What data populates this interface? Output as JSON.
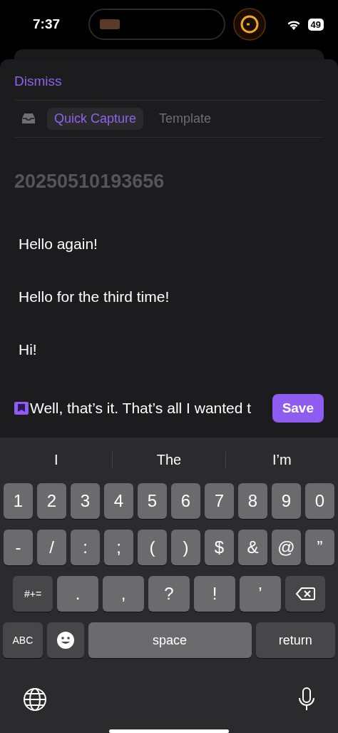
{
  "status_bar": {
    "time": "7:37",
    "battery": "49"
  },
  "sheet": {
    "dismiss": "Dismiss",
    "tabs": [
      {
        "label": "Quick Capture",
        "selected": true
      },
      {
        "label": "Template",
        "selected": false
      }
    ],
    "title_placeholder": "20250510193656",
    "lines": [
      "Hello again!",
      "Hello for the third time!",
      "Hi!",
      "Well, that’s it. That’s all I wanted t"
    ],
    "save": "Save"
  },
  "keyboard": {
    "suggestions": [
      "I",
      "The",
      "I’m"
    ],
    "rows": [
      {
        "keys": [
          {
            "label": "1",
            "kind": "char"
          },
          {
            "label": "2",
            "kind": "char"
          },
          {
            "label": "3",
            "kind": "char"
          },
          {
            "label": "4",
            "kind": "char"
          },
          {
            "label": "5",
            "kind": "char"
          },
          {
            "label": "6",
            "kind": "char"
          },
          {
            "label": "7",
            "kind": "char"
          },
          {
            "label": "8",
            "kind": "char"
          },
          {
            "label": "9",
            "kind": "char"
          },
          {
            "label": "0",
            "kind": "char"
          }
        ]
      },
      {
        "keys": [
          {
            "label": "-",
            "kind": "char"
          },
          {
            "label": "/",
            "kind": "char"
          },
          {
            "label": ":",
            "kind": "char"
          },
          {
            "label": ";",
            "kind": "char"
          },
          {
            "label": "(",
            "kind": "char"
          },
          {
            "label": ")",
            "kind": "char"
          },
          {
            "label": "$",
            "kind": "char"
          },
          {
            "label": "&",
            "kind": "char"
          },
          {
            "label": "@",
            "kind": "char"
          },
          {
            "label": "”",
            "kind": "char"
          }
        ]
      },
      {
        "keys": [
          {
            "label": "#+=",
            "kind": "mod"
          },
          {
            "label": ".",
            "kind": "wide"
          },
          {
            "label": ",",
            "kind": "wide"
          },
          {
            "label": "?",
            "kind": "wide"
          },
          {
            "label": "!",
            "kind": "wide"
          },
          {
            "label": "’",
            "kind": "wide"
          },
          {
            "kind": "delete"
          }
        ]
      },
      {
        "keys": [
          {
            "label": "ABC",
            "kind": "mod"
          },
          {
            "kind": "emoji"
          },
          {
            "label": "space",
            "kind": "space"
          },
          {
            "label": "return",
            "kind": "return"
          }
        ]
      }
    ]
  }
}
